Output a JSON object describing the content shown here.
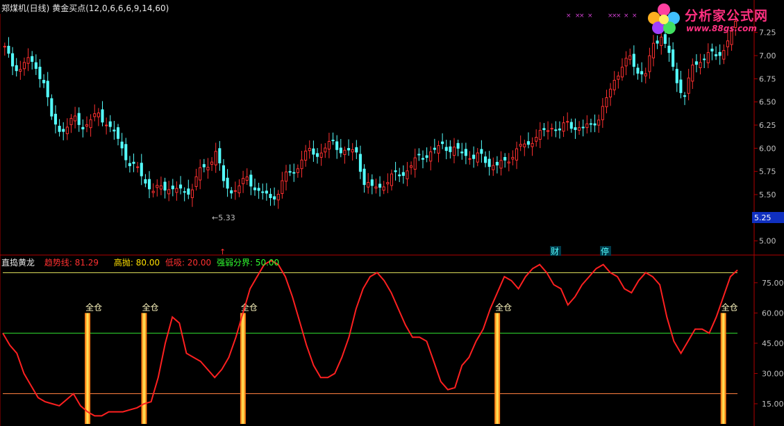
{
  "top_panel": {
    "stock_name": "郑煤机(日线)",
    "indicator_name": "黄金买点",
    "params": "(12,0,6,6,6,9,14,60)",
    "min_marker": "5.33",
    "price_tag": "5.25",
    "yaxis_ticks": [
      "7.25",
      "7.00",
      "6.75",
      "6.50",
      "6.25",
      "6.00",
      "5.75",
      "5.50",
      "5.25",
      "5.00"
    ],
    "markers": {
      "cai": "财",
      "ting": "停",
      "arrow": "↑"
    },
    "colors": {
      "up": "#ff3030",
      "down": "#54ffff",
      "price_tag_bg": "#1030c0"
    }
  },
  "bottom_panel": {
    "indicator_name": "直捣黄龙",
    "trend_label": "趋势线: 81.29",
    "high_label": "高抛: 80.00",
    "low_label": "低吸: 20.00",
    "mid_label": "强弱分界: 50.00",
    "yaxis_ticks": [
      "75.00",
      "60.00",
      "45.00",
      "30.00",
      "15.00"
    ],
    "signal_text": "全仓",
    "colors": {
      "trend": "#ff2020",
      "high": "#e8e860",
      "mid": "#30e030",
      "low": "#ff8040",
      "bar": "#ffb000"
    }
  },
  "watermark": {
    "title": "分析家公式网",
    "url": "www.88gs.com"
  },
  "chart_data": [
    {
      "type": "candlestick",
      "title": "郑煤机(日线) 黄金买点",
      "ylim": [
        4.9,
        7.45
      ],
      "yticks": [
        5.0,
        5.25,
        5.5,
        5.75,
        6.0,
        6.25,
        6.5,
        6.75,
        7.0,
        7.25
      ],
      "close_path": [
        7.1,
        6.85,
        6.9,
        6.95,
        6.85,
        6.75,
        6.3,
        6.2,
        6.25,
        6.3,
        6.25,
        6.3,
        6.35,
        6.3,
        6.15,
        6.0,
        5.85,
        5.75,
        5.65,
        5.55,
        5.55,
        5.6,
        5.55,
        5.5,
        5.6,
        5.75,
        5.8,
        6.0,
        5.6,
        5.55,
        5.6,
        5.65,
        5.6,
        5.5,
        5.45,
        5.55,
        5.7,
        5.75,
        5.9,
        5.95,
        5.95,
        6.0,
        6.05,
        6.0,
        5.95,
        5.95,
        5.65,
        5.55,
        5.6,
        5.65,
        5.7,
        5.75,
        5.8,
        5.9,
        5.95,
        5.95,
        6.05,
        6.0,
        5.95,
        5.95,
        5.9,
        5.9,
        5.85,
        5.8,
        5.85,
        5.95,
        6.0,
        6.05,
        6.15,
        6.15,
        6.25,
        6.2,
        6.25,
        6.25,
        6.2,
        6.25,
        6.35,
        6.5,
        6.75,
        6.9,
        6.95,
        6.85,
        6.8,
        7.1,
        7.25,
        7.0,
        6.7,
        6.6,
        6.85,
        6.95,
        7.05,
        6.95,
        7.1,
        7.25,
        7.4
      ],
      "min_marker_value": 5.33,
      "last_price": 5.25
    },
    {
      "type": "line",
      "title": "直捣黄龙",
      "ylim": [
        5,
        87
      ],
      "yticks": [
        15,
        30,
        45,
        60,
        75
      ],
      "series": [
        {
          "name": "趋势线",
          "values": [
            50,
            44,
            40,
            30,
            24,
            18,
            16,
            15,
            14,
            17,
            20,
            14,
            11,
            9,
            9,
            11,
            11,
            11,
            12,
            13,
            15,
            16,
            28,
            45,
            58,
            55,
            40,
            38,
            36,
            32,
            28,
            32,
            38,
            48,
            60,
            72,
            78,
            84,
            86,
            84,
            78,
            68,
            56,
            44,
            34,
            28,
            28,
            30,
            38,
            48,
            62,
            72,
            78,
            80,
            76,
            70,
            62,
            54,
            48,
            48,
            46,
            36,
            26,
            22,
            23,
            34,
            38,
            46,
            52,
            62,
            70,
            78,
            76,
            72,
            78,
            82,
            84,
            80,
            74,
            72,
            64,
            68,
            74,
            78,
            82,
            84,
            80,
            78,
            72,
            70,
            76,
            80,
            78,
            74,
            58,
            46,
            40,
            46,
            52,
            52,
            50,
            58,
            68,
            78,
            81.29
          ]
        },
        {
          "name": "高抛",
          "values": [
            80
          ]
        },
        {
          "name": "低吸",
          "values": [
            20
          ]
        },
        {
          "name": "强弱分界",
          "values": [
            50
          ]
        }
      ],
      "signals_at_index": [
        12,
        20,
        34,
        70,
        102
      ]
    }
  ]
}
